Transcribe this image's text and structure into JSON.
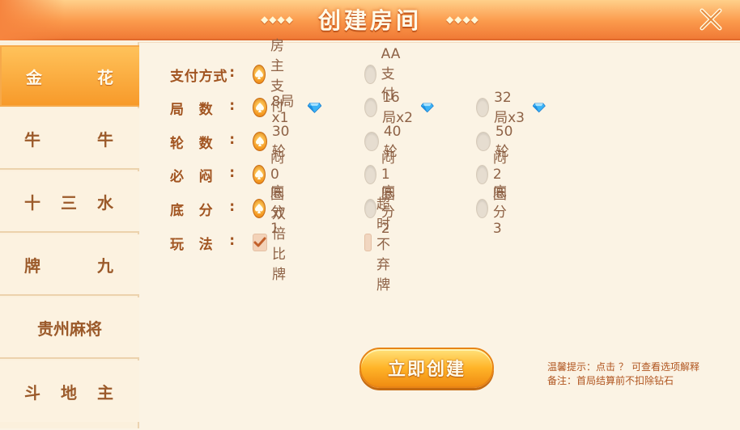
{
  "header": {
    "title": "创建房间",
    "left_ornament": "◆◆◆◆",
    "right_ornament": "◆◆◆◆"
  },
  "sidebar": {
    "items": [
      {
        "chars": [
          "金",
          "花"
        ],
        "active": true
      },
      {
        "chars": [
          "牛",
          "牛"
        ],
        "active": false
      },
      {
        "chars": [
          "十",
          "三",
          "水"
        ],
        "active": false
      },
      {
        "chars": [
          "牌",
          "九"
        ],
        "active": false
      },
      {
        "label": "贵州麻将",
        "active": false
      },
      {
        "chars": [
          "斗",
          "地",
          "主"
        ],
        "active": false
      }
    ]
  },
  "options": {
    "payment": {
      "label_chars": [
        "支",
        "付",
        "方",
        "式"
      ],
      "choices": [
        "房主支付",
        "AA支付"
      ],
      "selected": 0
    },
    "rounds": {
      "label_chars": [
        "局",
        "数"
      ],
      "choices": [
        "8局x1",
        "16局x2",
        "32局x3"
      ],
      "selected": 0
    },
    "turns": {
      "label_chars": [
        "轮",
        "数"
      ],
      "choices": [
        "30轮",
        "40轮",
        "50轮"
      ],
      "selected": 0
    },
    "must_blind": {
      "label_chars": [
        "必",
        "闷"
      ],
      "choices": [
        "闷0圈",
        "闷1圈",
        "闷2圈"
      ],
      "selected": 0
    },
    "base_score": {
      "label_chars": [
        "底",
        "分"
      ],
      "choices": [
        "底分1",
        "底分2",
        "底分3"
      ],
      "selected": 0
    },
    "rules": {
      "label_chars": [
        "玩",
        "法"
      ],
      "choices": [
        "双倍比牌",
        "超时不弃牌"
      ],
      "checked": [
        true,
        false
      ]
    }
  },
  "create_button": "立即创建",
  "tips": {
    "line1_prefix": "温馨提示：点击",
    "line1_q": "？",
    "line1_suffix": "可查看选项解释",
    "line2": "备注：首局结算前不扣除钻石"
  },
  "colors": {
    "accent": "#f59a22",
    "label": "#a15420",
    "gem": "#2aa3f0"
  }
}
